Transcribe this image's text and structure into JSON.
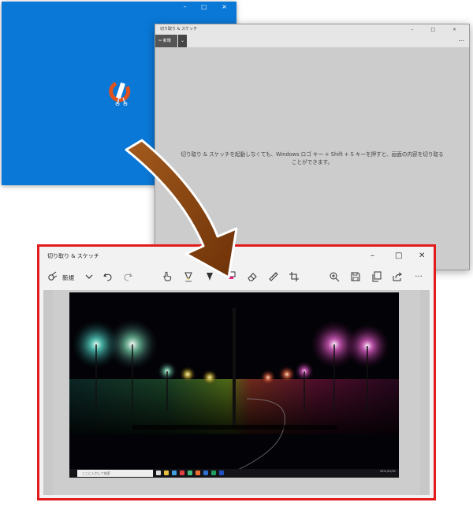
{
  "splash": {
    "window_caps": "– □ ×"
  },
  "background_window": {
    "title": "切り取り & スケッチ",
    "caps": "– □ ×",
    "new_label": "新規",
    "more": "...",
    "hint": "切り取り & スケッチを起動しなくても、Windows ロゴ キー + Shift + S キーを押すと、画面の内容を切り取ることができます。"
  },
  "main_window": {
    "title": "切り取り & スケッチ",
    "minimize": "–",
    "maximize": "□",
    "close": "✕",
    "new_label": "新規",
    "more": "···",
    "screenshot": {
      "search_placeholder": "ここに入力して検索",
      "tray_text": "2021/01/01"
    }
  },
  "colors": {
    "splash_blue": "#0a78d7",
    "frame_red": "#e21b1b",
    "arrow_brown": "#8a4512"
  },
  "icons": [
    "new-snip-icon",
    "chevron-down-icon",
    "undo-icon",
    "redo-icon",
    "touch-writing-icon",
    "ballpoint-pen-icon",
    "pencil-icon",
    "highlighter-icon",
    "eraser-icon",
    "ruler-icon",
    "crop-icon",
    "zoom-in-icon",
    "save-icon",
    "copy-icon",
    "share-icon",
    "more-icon"
  ]
}
